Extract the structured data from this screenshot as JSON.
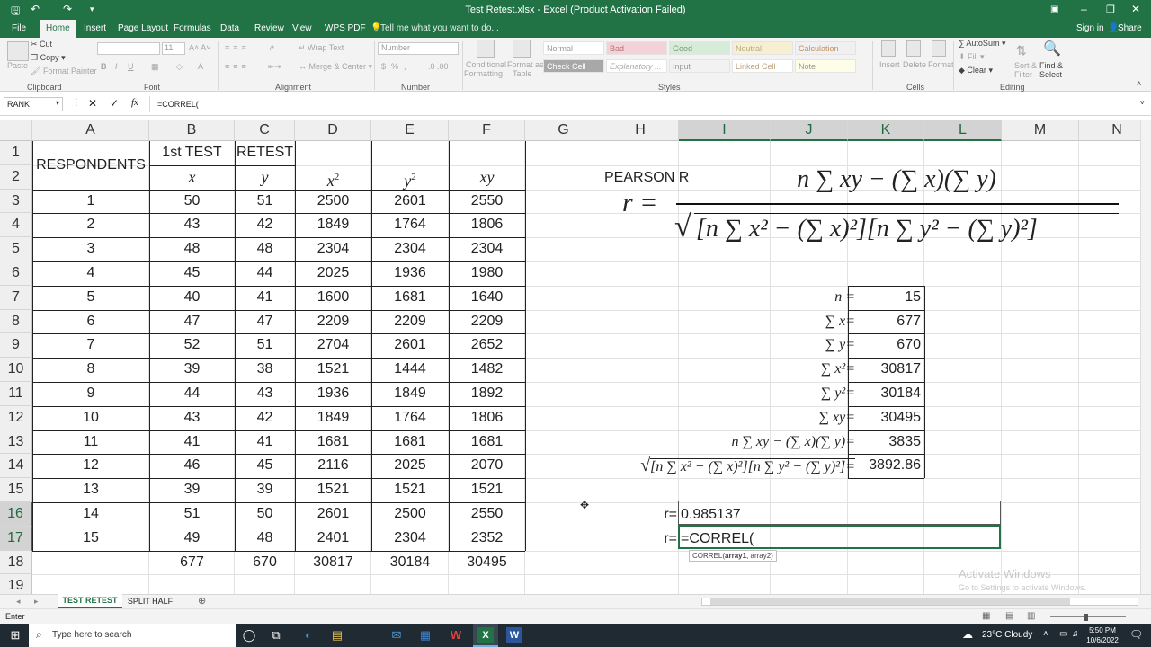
{
  "title_bar": {
    "title": "Test Retest.xlsx - Excel (Product Activation Failed)",
    "sign_in": "Sign in",
    "share": "Share"
  },
  "tabs": [
    "File",
    "Home",
    "Insert",
    "Page Layout",
    "Formulas",
    "Data",
    "View",
    "WPS PDF"
  ],
  "tell_me": "Tell me what you want to do...",
  "ribbon": {
    "cut": "Cut",
    "copy": "Copy",
    "format_painter": "Format Painter",
    "paste": "Paste",
    "font_size": "11",
    "wrap_text": "Wrap Text",
    "merge_center": "Merge & Center",
    "number_format": "Number",
    "conditional": "Conditional",
    "formatting": "Formatting",
    "format_as": "Format as",
    "table": "Table",
    "styles": {
      "normal": "Normal",
      "bad": "Bad",
      "good": "Good",
      "neutral": "Neutral",
      "calculation": "Calculation",
      "check_cell": "Check Cell",
      "explanatory": "Explanatory ...",
      "input": "Input",
      "linked_cell": "Linked Cell",
      "note": "Note"
    },
    "insert": "Insert",
    "delete": "Delete",
    "format": "Format",
    "autosum": "AutoSum",
    "fill": "Fill",
    "clear": "Clear",
    "sort": "Sort &",
    "filter": "Filter",
    "find": "Find &",
    "select": "Select",
    "groups": {
      "clipboard": "Clipboard",
      "font": "Font",
      "alignment": "Alignment",
      "number": "Number",
      "styles": "Styles",
      "cells": "Cells",
      "editing": "Editing"
    }
  },
  "formula_bar": {
    "name_box": "RANK",
    "formula": "=CORREL(",
    "fx": "fx"
  },
  "columns": [
    "A",
    "B",
    "C",
    "D",
    "E",
    "F",
    "G",
    "H",
    "I",
    "J",
    "K",
    "L",
    "M",
    "N"
  ],
  "rows": [
    "1",
    "2",
    "3",
    "4",
    "5",
    "6",
    "7",
    "8",
    "9",
    "10",
    "11",
    "12",
    "13",
    "14",
    "15",
    "16",
    "17",
    "18",
    "19"
  ],
  "table": {
    "respondents": "RESPONDENTS",
    "first_test": "1st TEST",
    "retest": "RETEST",
    "h_x": "x",
    "h_y": "y",
    "h_x2": "x",
    "h_y2": "y",
    "sup2": "2",
    "h_xy": "xy",
    "data": [
      [
        "1",
        "50",
        "51",
        "2500",
        "2601",
        "2550"
      ],
      [
        "2",
        "43",
        "42",
        "1849",
        "1764",
        "1806"
      ],
      [
        "3",
        "48",
        "48",
        "2304",
        "2304",
        "2304"
      ],
      [
        "4",
        "45",
        "44",
        "2025",
        "1936",
        "1980"
      ],
      [
        "5",
        "40",
        "41",
        "1600",
        "1681",
        "1640"
      ],
      [
        "6",
        "47",
        "47",
        "2209",
        "2209",
        "2209"
      ],
      [
        "7",
        "52",
        "51",
        "2704",
        "2601",
        "2652"
      ],
      [
        "8",
        "39",
        "38",
        "1521",
        "1444",
        "1482"
      ],
      [
        "9",
        "44",
        "43",
        "1936",
        "1849",
        "1892"
      ],
      [
        "10",
        "43",
        "42",
        "1849",
        "1764",
        "1806"
      ],
      [
        "11",
        "41",
        "41",
        "1681",
        "1681",
        "1681"
      ],
      [
        "12",
        "46",
        "45",
        "2116",
        "2025",
        "2070"
      ],
      [
        "13",
        "39",
        "39",
        "1521",
        "1521",
        "1521"
      ],
      [
        "14",
        "51",
        "50",
        "2601",
        "2500",
        "2550"
      ],
      [
        "15",
        "49",
        "48",
        "2401",
        "2304",
        "2352"
      ]
    ],
    "totals": [
      "677",
      "670",
      "30817",
      "30184",
      "30495"
    ]
  },
  "pearson": {
    "label": "PEARSON R",
    "formula_lhs": "r =",
    "numerator": "n ∑ xy − (∑ x)(∑ y)",
    "denominator": "[n ∑ x² − (∑ x)²][n ∑ y² − (∑ y)²]"
  },
  "summary": [
    {
      "label": "n =",
      "value": "15"
    },
    {
      "label": "∑ x=",
      "value": "677"
    },
    {
      "label": "∑ y=",
      "value": "670"
    },
    {
      "label": "∑ x²=",
      "value": "30817"
    },
    {
      "label": "∑ y²=",
      "value": "30184"
    },
    {
      "label": "∑ xy=",
      "value": "30495"
    },
    {
      "label": "n ∑ xy − (∑ x)(∑ y)=",
      "value": "3835"
    },
    {
      "label": "[n ∑ x² − (∑ x)²][n ∑ y² − (∑ y)²]=",
      "value": "3892.86"
    }
  ],
  "results": {
    "r_label": "r=",
    "r_value": "0.985137",
    "r2_label": "r=",
    "r2_value": "=CORREL(",
    "tooltip_fn": "CORREL(",
    "tooltip_arg1": "array1",
    "tooltip_rest": ", array2)"
  },
  "sheets": {
    "active": "TEST RETEST",
    "other": "SPLIT HALF"
  },
  "watermark": {
    "line1": "Activate Windows",
    "line2": "Go to Settings to activate Windows."
  },
  "status": {
    "mode": "Enter"
  },
  "taskbar": {
    "search": "Type here to search",
    "weather": "23°C  Cloudy",
    "time": "5:50 PM",
    "date": "10/6/2022"
  }
}
